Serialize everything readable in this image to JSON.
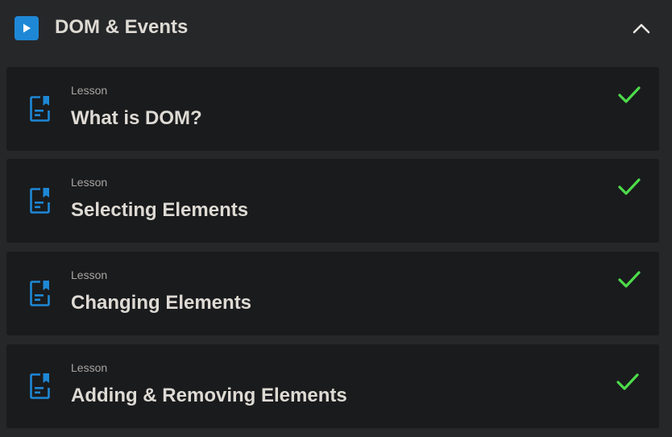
{
  "section": {
    "title": "DOM & Events",
    "badge_icon": "play-icon",
    "toggle_icon": "chevron-up-icon",
    "expanded": true
  },
  "lessons": [
    {
      "kicker": "Lesson",
      "title": "What is DOM?",
      "icon": "document-bookmark-icon",
      "status_icon": "checkmark-icon",
      "completed": true
    },
    {
      "kicker": "Lesson",
      "title": "Selecting Elements",
      "icon": "document-bookmark-icon",
      "status_icon": "checkmark-icon",
      "completed": true
    },
    {
      "kicker": "Lesson",
      "title": "Changing Elements",
      "icon": "document-bookmark-icon",
      "status_icon": "checkmark-icon",
      "completed": true
    },
    {
      "kicker": "Lesson",
      "title": "Adding & Removing Elements",
      "icon": "document-bookmark-icon",
      "status_icon": "checkmark-icon",
      "completed": true
    }
  ],
  "colors": {
    "background": "#262729",
    "card": "#1a1b1d",
    "accent_blue": "#1e88d6",
    "check_green": "#4ddc4a",
    "title_text": "#dedad4",
    "kicker_text": "#a8a6a2"
  }
}
